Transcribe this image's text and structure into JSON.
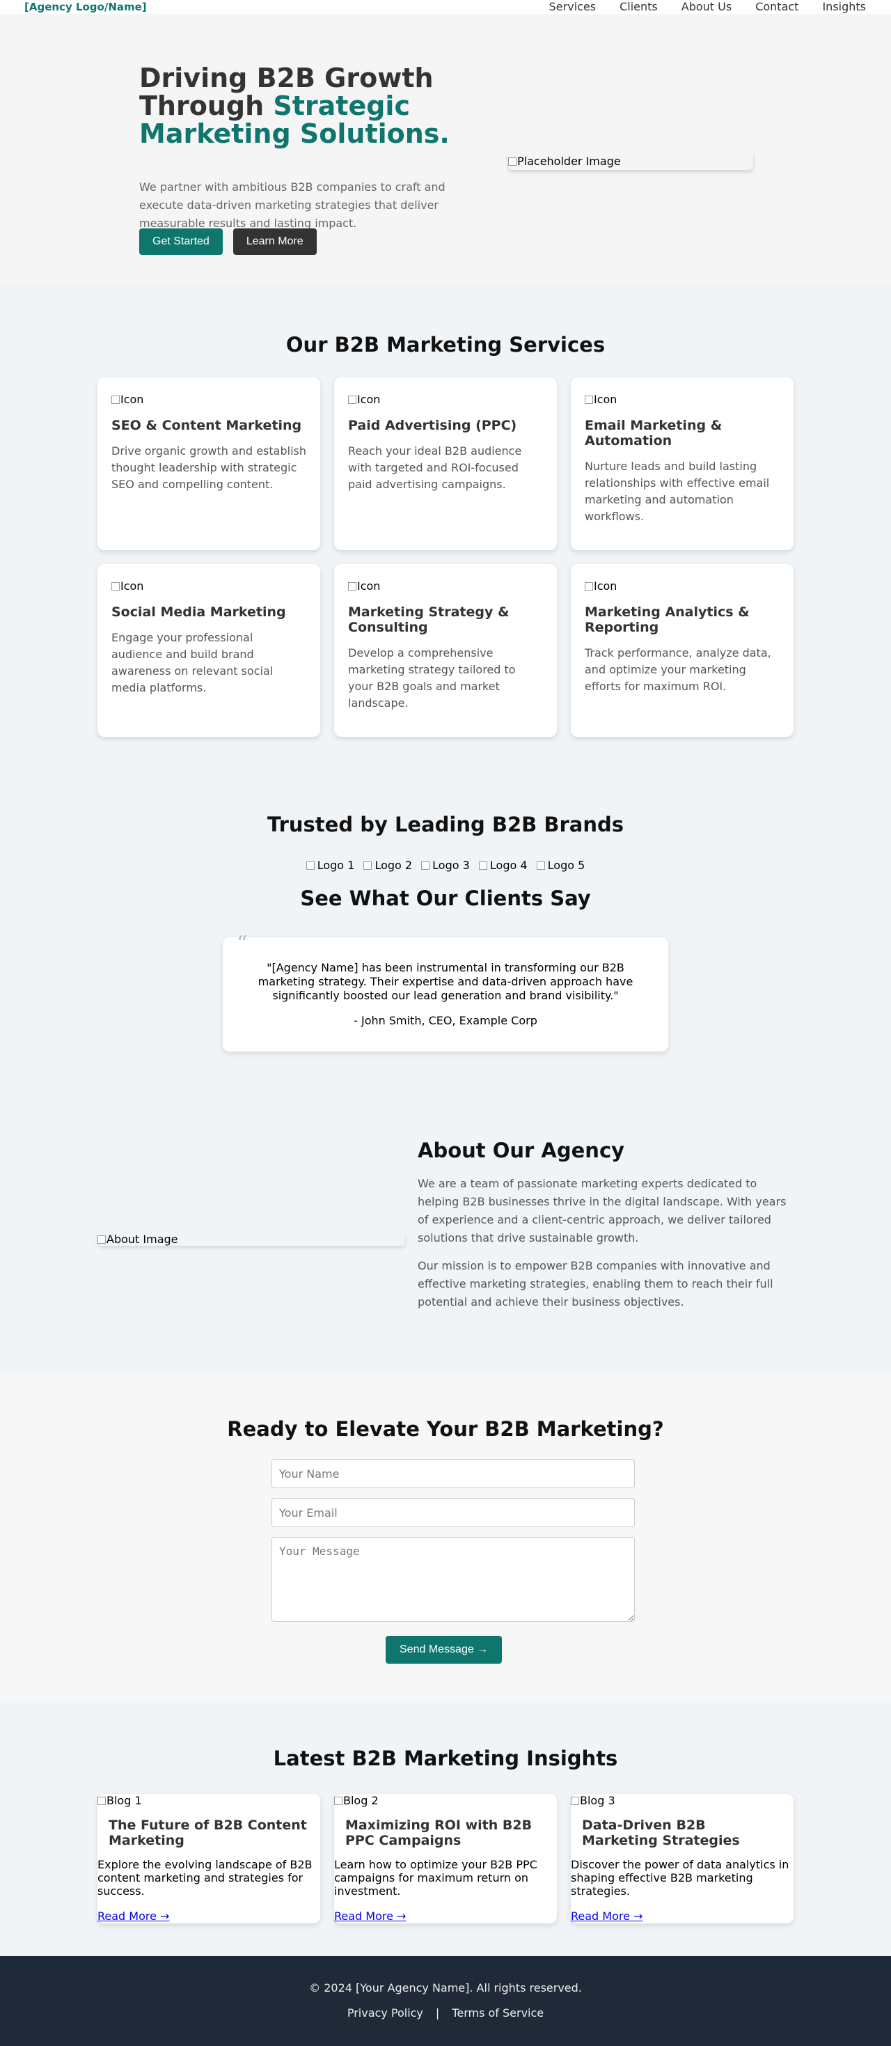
{
  "nav": {
    "logo": "[Agency Logo/Name]",
    "links": [
      "Services",
      "Clients",
      "About Us",
      "Contact",
      "Insights"
    ]
  },
  "hero": {
    "title_line1": "Driving B2B Growth",
    "title_line2_plain": "Through ",
    "title_accent": "Strategic Marketing Solutions.",
    "subtitle": "We partner with ambitious B2B companies to craft and execute data-driven marketing strategies that deliver measurable results and lasting impact.",
    "primary_button": "Get Started",
    "secondary_button": "Learn More",
    "image_alt": "Placeholder Image"
  },
  "services": {
    "title": "Our B2B Marketing Services",
    "items": [
      {
        "icon_alt": "Icon",
        "title": "SEO & Content Marketing",
        "text": "Drive organic growth and establish thought leadership with strategic SEO and compelling content."
      },
      {
        "icon_alt": "Icon",
        "title": "Paid Advertising (PPC)",
        "text": "Reach your ideal B2B audience with targeted and ROI-focused paid advertising campaigns."
      },
      {
        "icon_alt": "Icon",
        "title": "Email Marketing & Automation",
        "text": "Nurture leads and build lasting relationships with effective email marketing and automation workflows."
      },
      {
        "icon_alt": "Icon",
        "title": "Social Media Marketing",
        "text": "Engage your professional audience and build brand awareness on relevant social media platforms."
      },
      {
        "icon_alt": "Icon",
        "title": "Marketing Strategy & Consulting",
        "text": "Develop a comprehensive marketing strategy tailored to your B2B goals and market landscape."
      },
      {
        "icon_alt": "Icon",
        "title": "Marketing Analytics & Reporting",
        "text": "Track performance, analyze data, and optimize your marketing efforts for maximum ROI."
      }
    ]
  },
  "trusted": {
    "title": "Trusted by Leading B2B Brands",
    "logos": [
      "Logo 1",
      "Logo 2",
      "Logo 3",
      "Logo 4",
      "Logo 5"
    ]
  },
  "testimonials": {
    "title": "See What Our Clients Say",
    "quote_mark": "“",
    "quote": "\"[Agency Name] has been instrumental in transforming our B2B marketing strategy. Their expertise and data-driven approach have significantly boosted our lead generation and brand visibility.\"",
    "author": "- John Smith, CEO, Example Corp"
  },
  "about": {
    "image_alt": "About Image",
    "title": "About Our Agency",
    "paragraph1": "We are a team of passionate marketing experts dedicated to helping B2B businesses thrive in the digital landscape. With years of experience and a client-centric approach, we deliver tailored solutions that drive sustainable growth.",
    "paragraph2": "Our mission is to empower B2B companies with innovative and effective marketing strategies, enabling them to reach their full potential and achieve their business objectives."
  },
  "contact": {
    "title": "Ready to Elevate Your B2B Marketing?",
    "name_placeholder": "Your Name",
    "email_placeholder": "Your Email",
    "message_placeholder": "Your Message",
    "submit": "Send Message →"
  },
  "insights": {
    "title": "Latest B2B Marketing Insights",
    "posts": [
      {
        "image_alt": "Blog 1",
        "title": "The Future of B2B Content Marketing",
        "excerpt": "Explore the evolving landscape of B2B content marketing and strategies for success.",
        "link": "Read More →"
      },
      {
        "image_alt": "Blog 2",
        "title": "Maximizing ROI with B2B PPC Campaigns",
        "excerpt": "Learn how to optimize your B2B PPC campaigns for maximum return on investment.",
        "link": "Read More →"
      },
      {
        "image_alt": "Blog 3",
        "title": "Data-Driven B2B Marketing Strategies",
        "excerpt": "Discover the power of data analytics in shaping effective B2B marketing strategies.",
        "link": "Read More →"
      }
    ]
  },
  "footer": {
    "copyright": "© 2024 [Your Agency Name]. All rights reserved.",
    "privacy": "Privacy Policy",
    "separator": "|",
    "terms": "Terms of Service"
  },
  "colors": {
    "accent": "#0f766e",
    "dark_button": "#333333",
    "footer_bg": "#1f2937"
  }
}
